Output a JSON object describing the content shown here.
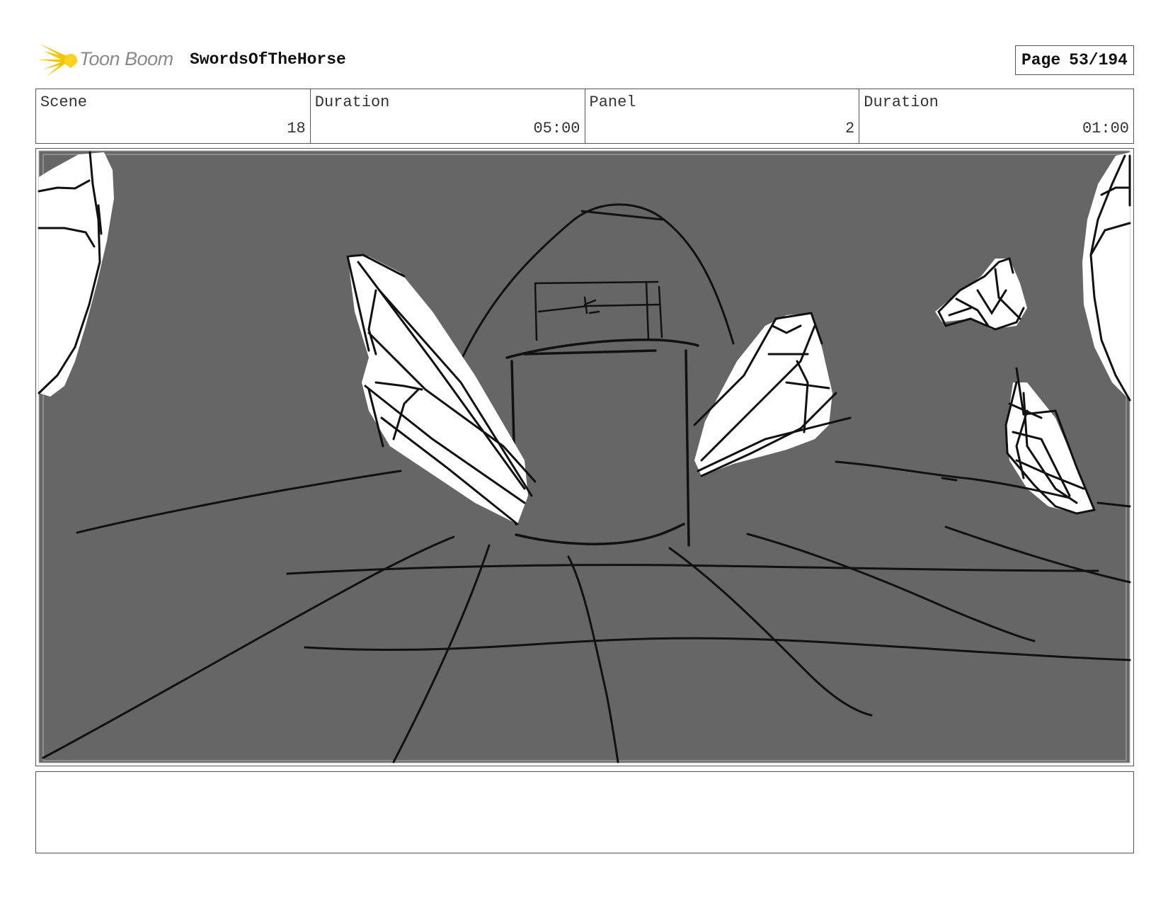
{
  "header": {
    "brand": "Toon Boom",
    "project_title": "SwordsOfTheHorse",
    "page_label": "Page",
    "page_number": "53/194"
  },
  "info": {
    "scene_label": "Scene",
    "scene_value": "18",
    "scene_duration_label": "Duration",
    "scene_duration_value": "05:00",
    "panel_label": "Panel",
    "panel_value": "2",
    "panel_duration_label": "Duration",
    "panel_duration_value": "01:00"
  },
  "colors": {
    "brand_yellow": "#f5c400",
    "sketch_background": "#666666",
    "ink": "#111111"
  },
  "notes": {
    "text": ""
  }
}
